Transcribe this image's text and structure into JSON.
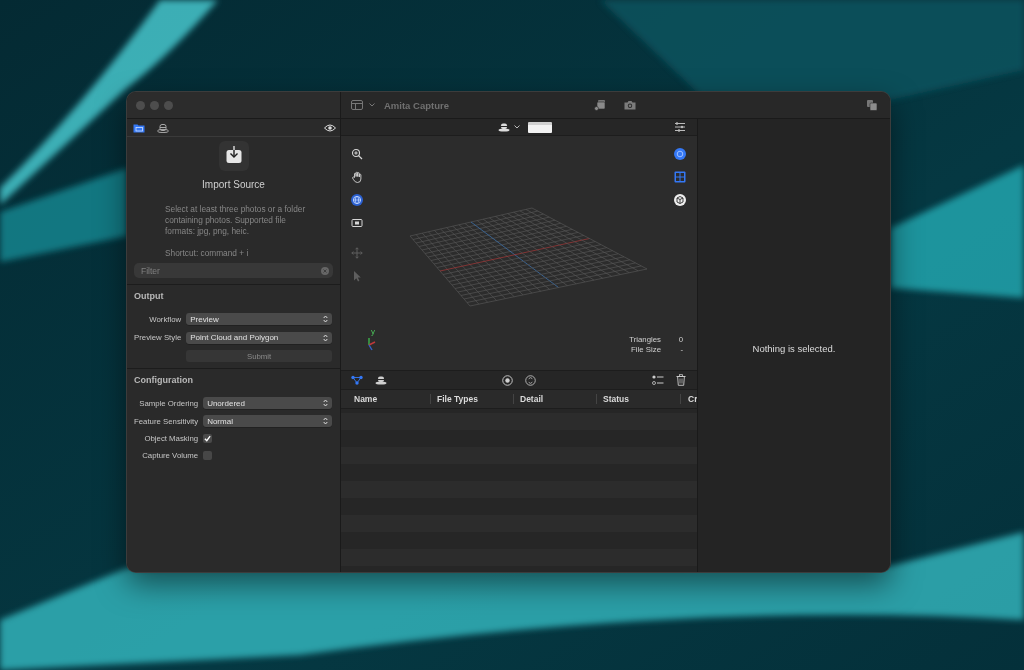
{
  "window": {
    "title": "Amita Capture"
  },
  "sidebar": {
    "tabs": [
      {
        "selected": true
      },
      {
        "selected": false
      }
    ],
    "import": {
      "title": "Import Source",
      "description": "Select at least three photos or a folder containing photos. Supported file formats: jpg, png, heic.",
      "shortcut": "Shortcut: command + i"
    },
    "filter": {
      "placeholder": "Filter"
    },
    "output": {
      "heading": "Output",
      "fields": [
        {
          "label": "Workflow",
          "value": "Preview"
        },
        {
          "label": "Preview Style",
          "value": "Point Cloud and Polygon"
        }
      ],
      "submit": {
        "label": "Submit",
        "disabled": true
      }
    },
    "configuration": {
      "heading": "Configuration",
      "fields": [
        {
          "kind": "select",
          "label": "Sample Ordering",
          "value": "Unordered"
        },
        {
          "kind": "select",
          "label": "Feature Sensitivity",
          "value": "Normal"
        },
        {
          "kind": "checkbox",
          "label": "Object Masking",
          "checked": true
        },
        {
          "kind": "checkbox",
          "label": "Capture Volume",
          "checked": false
        }
      ]
    }
  },
  "viewport": {
    "view_tools": [
      {
        "selected": false
      },
      {
        "selected": false
      },
      {
        "selected": true
      },
      {
        "selected": false
      }
    ],
    "edit_tools": [
      {
        "disabled": true
      },
      {
        "disabled": true
      }
    ],
    "right_tools": [
      {
        "on": true
      },
      {
        "on": true
      },
      {
        "on": false
      }
    ],
    "axis_label": "y",
    "stats": [
      {
        "label": "Triangles",
        "value": "0"
      },
      {
        "label": "File Size",
        "value": "-"
      }
    ]
  },
  "table_toolbar": {
    "views": [
      {
        "selected": true
      },
      {
        "selected": false
      }
    ]
  },
  "table": {
    "columns": [
      "Name",
      "File Types",
      "Detail",
      "Status",
      "Cr"
    ]
  },
  "inspector": {
    "message": "Nothing is selected."
  }
}
